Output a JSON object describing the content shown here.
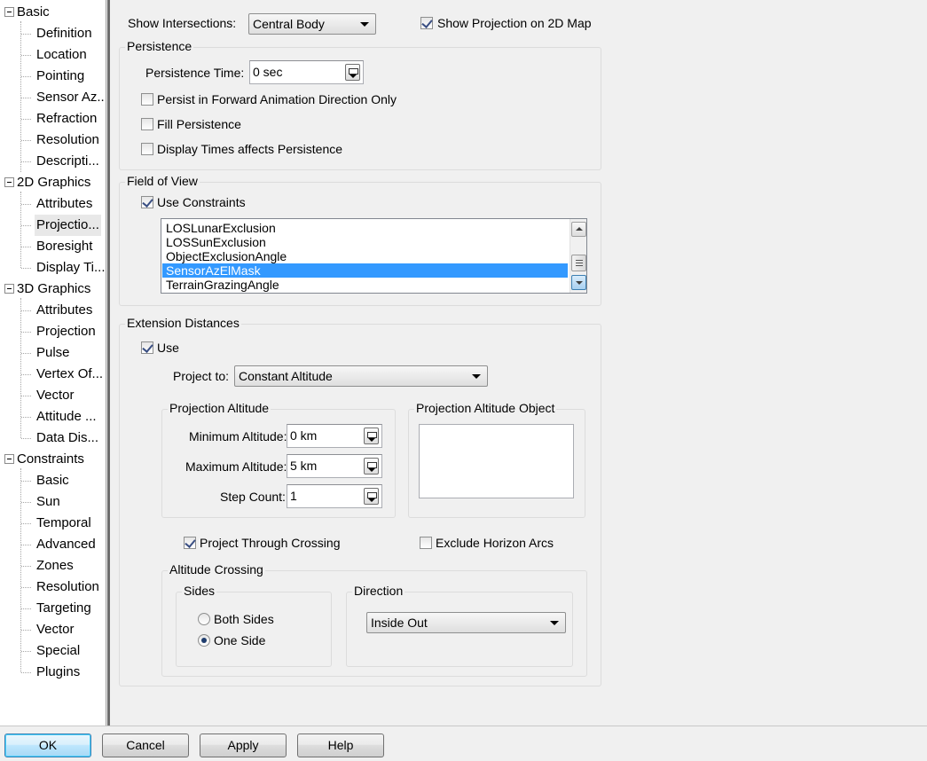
{
  "tree": {
    "groups": [
      {
        "label": "Basic",
        "children": [
          "Definition",
          "Location",
          "Pointing",
          "Sensor Az...",
          "Refraction",
          "Resolution",
          "Descripti..."
        ]
      },
      {
        "label": "2D Graphics",
        "children": [
          "Attributes",
          "Projectio...",
          "Boresight",
          "Display Ti..."
        ]
      },
      {
        "label": "3D Graphics",
        "children": [
          "Attributes",
          "Projection",
          "Pulse",
          "Vertex Of...",
          "Vector",
          "Attitude ...",
          "Data Dis..."
        ]
      },
      {
        "label": "Constraints",
        "children": [
          "Basic",
          "Sun",
          "Temporal",
          "Advanced",
          "Zones",
          "Resolution",
          "Targeting",
          "Vector",
          "Special",
          "Plugins"
        ]
      }
    ],
    "selected": "2D Graphics / Projectio..."
  },
  "top": {
    "show_intersections_label": "Show Intersections:",
    "show_intersections_value": "Central Body",
    "show_projection_label": "Show Projection on 2D Map",
    "show_projection_checked": true
  },
  "persistence": {
    "title": "Persistence",
    "time_label": "Persistence Time:",
    "time_value": "0 sec",
    "forward_only_label": "Persist in Forward Animation Direction Only",
    "fill_label": "Fill Persistence",
    "display_times_label": "Display Times affects Persistence"
  },
  "fov": {
    "title": "Field of View",
    "use_constraints_label": "Use Constraints",
    "use_constraints_checked": true,
    "items": [
      "LOSLunarExclusion",
      "LOSSunExclusion",
      "ObjectExclusionAngle",
      "SensorAzElMask",
      "TerrainGrazingAngle"
    ],
    "selected_item": "SensorAzElMask"
  },
  "extension": {
    "title": "Extension Distances",
    "use_label": "Use",
    "use_checked": true,
    "project_to_label": "Project to:",
    "project_to_value": "Constant Altitude",
    "projection_altitude": {
      "title": "Projection Altitude",
      "min_label": "Minimum Altitude:",
      "min_value": "0 km",
      "max_label": "Maximum Altitude:",
      "max_value": "5 km",
      "step_label": "Step Count:",
      "step_value": "1"
    },
    "altitude_object_title": "Projection Altitude Object",
    "project_through_label": "Project Through Crossing",
    "project_through_checked": true,
    "exclude_horizon_label": "Exclude Horizon Arcs",
    "exclude_horizon_checked": false,
    "altitude_crossing": {
      "title": "Altitude Crossing",
      "sides_title": "Sides",
      "both_sides_label": "Both Sides",
      "one_side_label": "One Side",
      "selected_side": "One Side",
      "direction_title": "Direction",
      "direction_value": "Inside Out"
    }
  },
  "buttons": {
    "ok": "OK",
    "cancel": "Cancel",
    "apply": "Apply",
    "help": "Help"
  }
}
